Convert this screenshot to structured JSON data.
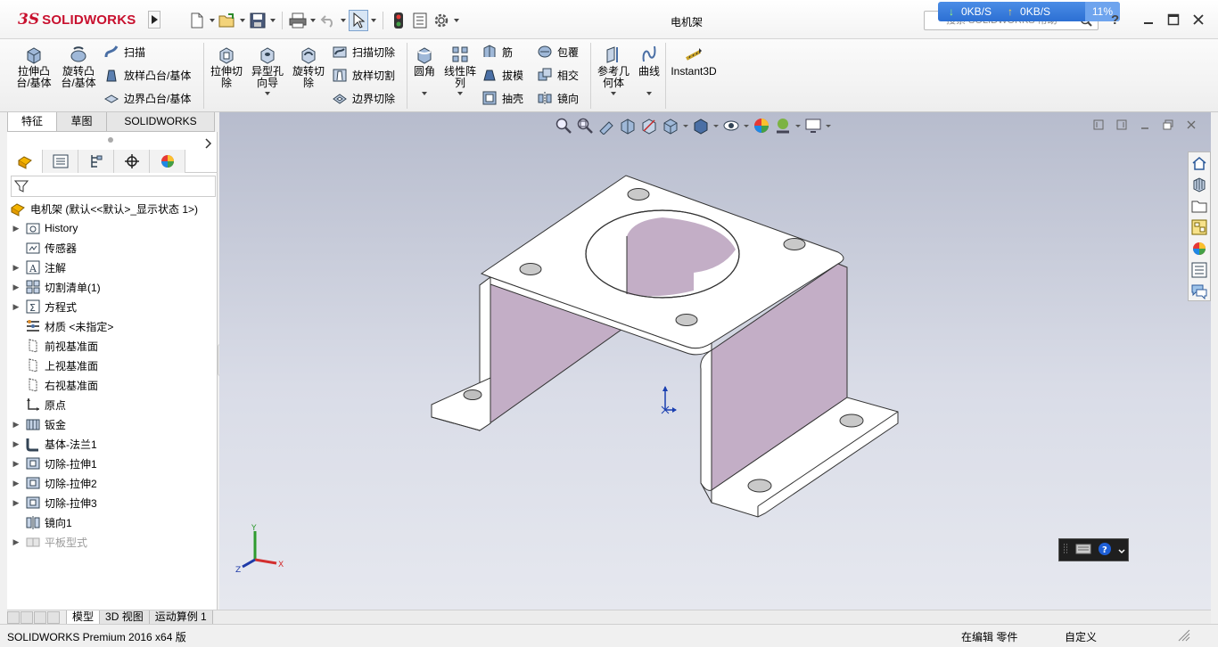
{
  "app": {
    "logo_prefix": "3S",
    "logo_name": "SOLIDWORKS",
    "document_title": "电机架"
  },
  "network": {
    "download": "0KB/S",
    "upload": "0KB/S",
    "usage": "11%"
  },
  "search": {
    "placeholder": "搜索 SOLIDWORKS 帮助"
  },
  "help_label": "?",
  "quick_tools": [
    "new-file-icon",
    "open-file-icon",
    "save-icon",
    "print-icon",
    "undo-icon",
    "select-pointer-icon",
    "rebuild-icon",
    "file-properties-icon",
    "options-gear-icon"
  ],
  "ribbon": {
    "extrude_boss": "拉伸凸台/基体",
    "revolve_boss": "旋转凸台/基体",
    "sweep": "扫描",
    "loft": "放样凸台/基体",
    "boundary": "边界凸台/基体",
    "extrude_cut": "拉伸切除",
    "hole_wizard": "异型孔向导",
    "revolve_cut": "旋转切除",
    "sweep_cut": "扫描切除",
    "loft_cut": "放样切割",
    "boundary_cut": "边界切除",
    "fillet": "圆角",
    "linear_pattern": "线性阵列",
    "rib": "筋",
    "draft": "拔模",
    "shell": "抽壳",
    "wrap": "包覆",
    "intersect": "相交",
    "mirror": "镜向",
    "ref_geometry": "参考几何体",
    "curves": "曲线",
    "instant3d": "Instant3D"
  },
  "command_tabs": [
    "特征",
    "草图",
    "SOLIDWORKS MBD"
  ],
  "feature_tree": {
    "root": "电机架  (默认<<默认>_显示状态 1>)",
    "items": [
      {
        "label": "History",
        "icon": "history-folder-icon",
        "expandable": true
      },
      {
        "label": "传感器",
        "icon": "sensor-folder-icon",
        "expandable": false
      },
      {
        "label": "注解",
        "icon": "annotation-icon",
        "expandable": true
      },
      {
        "label": "切割清单(1)",
        "icon": "cutlist-icon",
        "expandable": true
      },
      {
        "label": "方程式",
        "icon": "equation-icon",
        "expandable": true
      },
      {
        "label": "材质 <未指定>",
        "icon": "material-icon",
        "expandable": false
      },
      {
        "label": "前视基准面",
        "icon": "plane-icon",
        "expandable": false
      },
      {
        "label": "上视基准面",
        "icon": "plane-icon",
        "expandable": false
      },
      {
        "label": "右视基准面",
        "icon": "plane-icon",
        "expandable": false
      },
      {
        "label": "原点",
        "icon": "origin-icon",
        "expandable": false
      },
      {
        "label": "钣金",
        "icon": "sheetmetal-icon",
        "expandable": true
      },
      {
        "label": "基体-法兰1",
        "icon": "base-flange-icon",
        "expandable": true
      },
      {
        "label": "切除-拉伸1",
        "icon": "cut-extrude-icon",
        "expandable": true
      },
      {
        "label": "切除-拉伸2",
        "icon": "cut-extrude-icon",
        "expandable": true
      },
      {
        "label": "切除-拉伸3",
        "icon": "cut-extrude-icon",
        "expandable": true
      },
      {
        "label": "镜向1",
        "icon": "mirror-feature-icon",
        "expandable": false
      },
      {
        "label": "平板型式",
        "icon": "flat-pattern-icon",
        "expandable": true,
        "suppressed": true
      }
    ]
  },
  "bottom_tabs": [
    "模型",
    "3D 视图",
    "运动算例 1"
  ],
  "triad": {
    "x": "X",
    "y": "Y",
    "z": "Z"
  },
  "status": {
    "product": "SOLIDWORKS Premium 2016 x64 版",
    "editing": "在编辑 零件",
    "custom": "自定义"
  },
  "colors": {
    "brand": "#c8102e",
    "part_face": "#ffffff",
    "part_inner": "#c6b2c8",
    "viewport_top": "#b7bccd"
  }
}
